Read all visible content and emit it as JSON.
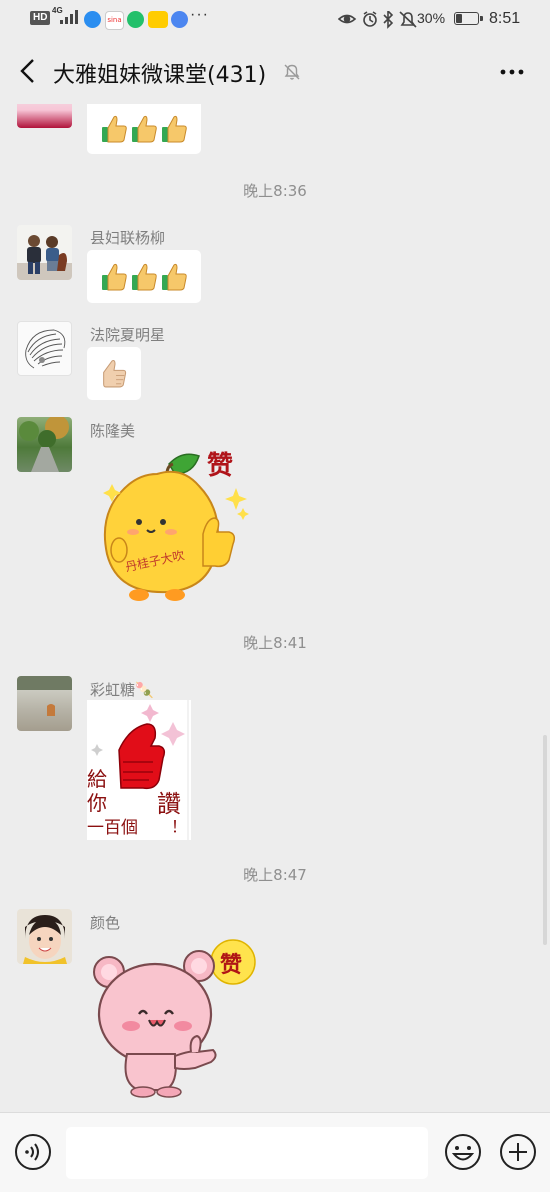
{
  "status_bar": {
    "hd": "HD",
    "network": "4G",
    "overflow": "···",
    "battery_text": "30%",
    "battery_level": 0.3,
    "time": "8:51"
  },
  "header": {
    "title": "大雅姐妹微课堂(431)",
    "muted": true
  },
  "messages": [
    {
      "sender": "",
      "content": "three-thumbs-up-emoji"
    },
    {
      "timestamp": "晚上8:36"
    },
    {
      "sender": "县妇联杨柳",
      "content": "three-thumbs-up-emoji"
    },
    {
      "sender": "法院夏明星",
      "content": "one-thumbs-up-emoji"
    },
    {
      "sender": "陈隆美",
      "content": "yellow-fruit-thumbs-up-sticker",
      "sticker_text": "赞",
      "sticker_caption": "丹桂子大吹"
    },
    {
      "timestamp": "晚上8:41"
    },
    {
      "sender": "彩虹糖🍡",
      "content": "red-hand-thumbs-up-sticker",
      "sticker_lines": [
        "給",
        "你",
        "一百個",
        "讚",
        "！"
      ]
    },
    {
      "timestamp": "晚上8:47"
    },
    {
      "sender": "颜色",
      "content": "pink-bear-thumbs-up-sticker",
      "sticker_text": "赞"
    }
  ],
  "input_bar": {
    "placeholder": "",
    "value": ""
  },
  "colors": {
    "background": "#ededed",
    "bubble": "#ffffff",
    "timestamp": "#8f8f8f",
    "sender": "#7f7f7f"
  }
}
